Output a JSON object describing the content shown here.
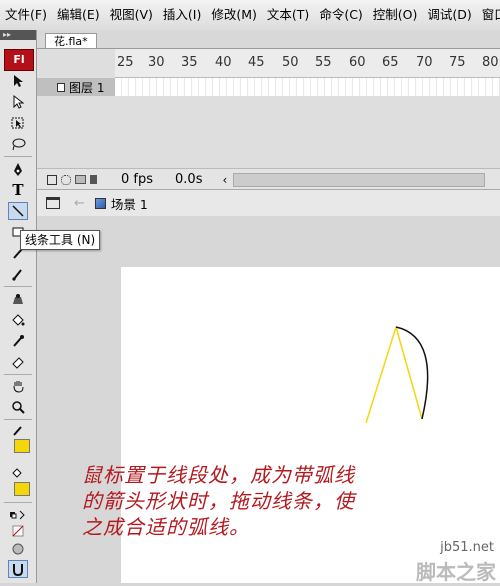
{
  "menu": {
    "items": [
      "文件(F)",
      "编辑(E)",
      "视图(V)",
      "插入(I)",
      "修改(M)",
      "文本(T)",
      "命令(C)",
      "控制(O)",
      "调试(D)",
      "窗口"
    ]
  },
  "document": {
    "tab_label": "花.fla*"
  },
  "toolbox": {
    "logo": "Fl",
    "text_tool_glyph": "T",
    "tooltip": "线条工具 (N)"
  },
  "timeline": {
    "ruler_numbers": [
      "25",
      "30",
      "35",
      "40",
      "45",
      "50",
      "55",
      "60",
      "65",
      "70",
      "75",
      "80"
    ],
    "layer_name": "图层 1",
    "fps": "0 fps",
    "time": "0.0s"
  },
  "editbar": {
    "scene_label": "场景 1"
  },
  "annotation": {
    "lines": [
      "鼠标置于线段处，成为带弧线",
      "的箭头形状时，拖动线条，使",
      "之成合适的弧线。"
    ]
  },
  "watermark": {
    "url": "jb51.net",
    "name": "脚本之家"
  },
  "colors": {
    "stroke": "#f5d60a",
    "annotation": "#b3191f",
    "logo": "#b3101a"
  }
}
